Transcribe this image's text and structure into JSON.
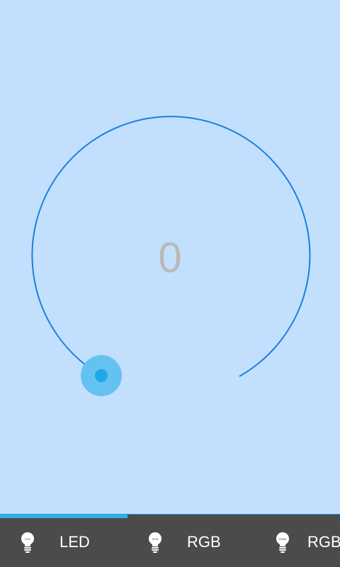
{
  "dial": {
    "value": "0",
    "level_fraction": 0.0
  },
  "colors": {
    "background": "#c2e0fd",
    "arc": "#1c7fe0",
    "knob_outer": "#63c2ef",
    "knob_inner": "#1ea9e6",
    "value_text": "#b9b9b9",
    "tabbar": "#4b4b4b",
    "tab_indicator": "#31b0e8"
  },
  "tabs": [
    {
      "label": "LED",
      "icon": "bulb-led-icon",
      "icon_text": "LED",
      "selected": true
    },
    {
      "label": "RGB",
      "icon": "bulb-rgb-icon",
      "icon_text": "RGB",
      "selected": false
    },
    {
      "label": "RGBW",
      "icon": "bulb-rgbw-icon",
      "icon_text": "RGBW",
      "selected": false
    }
  ]
}
